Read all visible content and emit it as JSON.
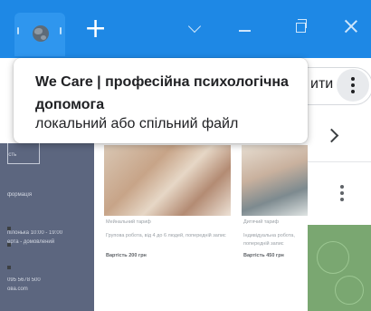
{
  "tab": {
    "icon": "globe-icon",
    "new_tab_symbol": "+"
  },
  "window_controls": {
    "dropdown_icon": "chevron-down-icon",
    "minimize_icon": "minimize-icon",
    "restore_icon": "restore-icon",
    "close_icon": "close-icon"
  },
  "hover_card": {
    "title": "We Care | професійна психологічна допомога",
    "subtitle": "локальний або спільний файл"
  },
  "toolbar": {
    "action_label_partial": "ити",
    "more_icon": "more-vert-icon",
    "next_icon": "chevron-right-icon"
  },
  "page": {
    "left_panel_lines": [
      "ість",
      "формація",
      "пілонька 10:00 - 19:00",
      "ерта - домовлений",
      "095 5678 500",
      "ова.com"
    ],
    "cards": [
      {
        "name": "Мейнальний тариф",
        "desc": "Групова робота, від 4 до 6 людей, попередній запис",
        "price": "Вартість 200 грн"
      },
      {
        "name": "Дитячий тариф",
        "desc": "Індивідуальна робота, попередній запис",
        "price": "Вартість 450 грн"
      }
    ]
  },
  "colors": {
    "titlebar": "#1e88e5",
    "active_tab": "#2f96ee",
    "left_panel": "#5c667f",
    "right_panel": "#7aa771"
  }
}
